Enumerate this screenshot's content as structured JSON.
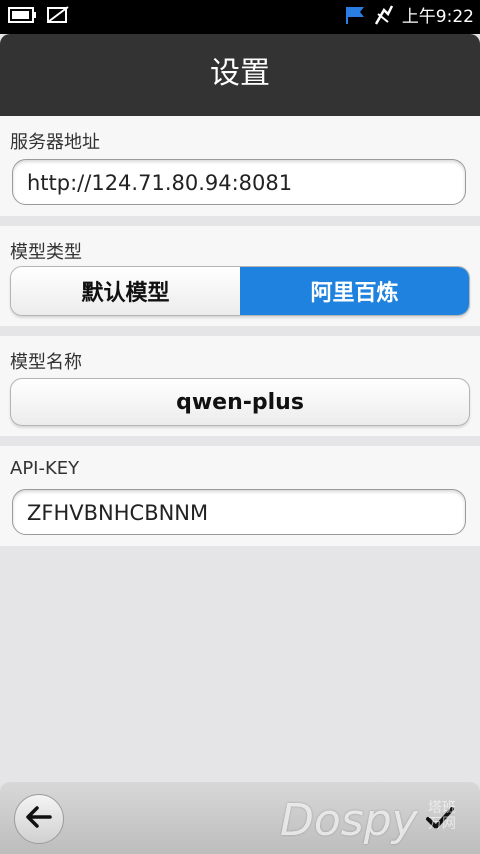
{
  "status_bar": {
    "time": "上午9:22",
    "icons": [
      "battery-icon",
      "no-sim-icon",
      "flag-icon",
      "signal-off-icon"
    ]
  },
  "header": {
    "title": "设置"
  },
  "server": {
    "label": "服务器地址",
    "value": "http://124.71.80.94:8081"
  },
  "model_type": {
    "label": "模型类型",
    "options": [
      "默认模型",
      "阿里百炼"
    ],
    "selected": "阿里百炼"
  },
  "model_name": {
    "label": "模型名称",
    "value": "qwen-plus"
  },
  "api_key": {
    "label": "API-KEY",
    "value": "ZFHVBNHCBNNM"
  },
  "toolbar": {
    "back_icon": "back-arrow-icon",
    "confirm_icon": "checkmark-icon"
  },
  "watermark": {
    "brand": "Dospy",
    "sub": "塔班 万网"
  },
  "colors": {
    "accent": "#1e82de",
    "titlebar": "#333333"
  }
}
